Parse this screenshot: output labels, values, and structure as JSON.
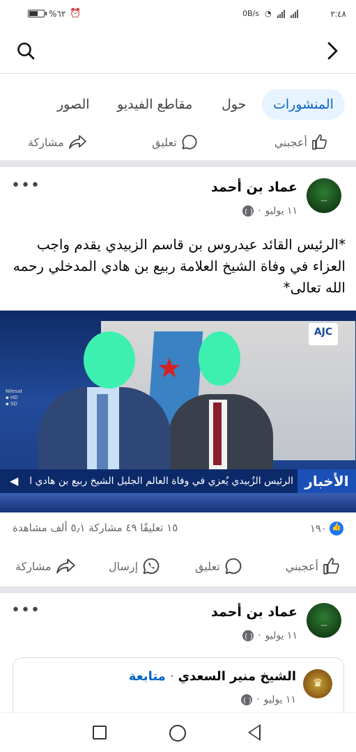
{
  "status_bar": {
    "time": "٢:٤٨",
    "battery": "%٦٢",
    "net_speed": "0B/s"
  },
  "tabs": [
    {
      "label": "المنشورات",
      "active": true
    },
    {
      "label": "حول"
    },
    {
      "label": "مقاطع الفيديو"
    },
    {
      "label": "الصور"
    }
  ],
  "prev_actions": {
    "like": "أعجبني",
    "comment": "تعليق",
    "share": "مشاركة"
  },
  "post1": {
    "author": "عماد بن أحمد",
    "date": "١١ يوليو",
    "text": "*الرئيس القائد عيدروس بن قاسم الزبيدي يقدم واجب العزاء في وفاة الشيخ العلامة ربيع بن هادي المدخلي رحمه الله تعالى*",
    "image": {
      "channel_logo": "AJC",
      "ticker_tag": "الأخبار",
      "ticker_text": "الرئيس الزُبيدي يُعزي في وفاة العالم الجليل الشيخ ربيع بن هادي المدخلي"
    },
    "stats": {
      "reactions": "١٩٠",
      "comments": "١٥ تعليقًا",
      "shares": "٤٩ مشاركة",
      "views": "٥٫١ ألف مشاهدة"
    },
    "actions": {
      "like": "أعجبني",
      "comment": "تعليق",
      "send": "إرسال",
      "share": "مشاركة"
    }
  },
  "post2": {
    "author": "عماد بن أحمد",
    "date": "١١ يوليو",
    "shared": {
      "author": "الشيخ منير السعدي",
      "follow": "متابعة",
      "date": "١١ يوليو"
    }
  },
  "colors": {
    "accent": "#0866c6",
    "tab_active_bg": "#e7f3ff",
    "secondary_text": "#65676b"
  }
}
